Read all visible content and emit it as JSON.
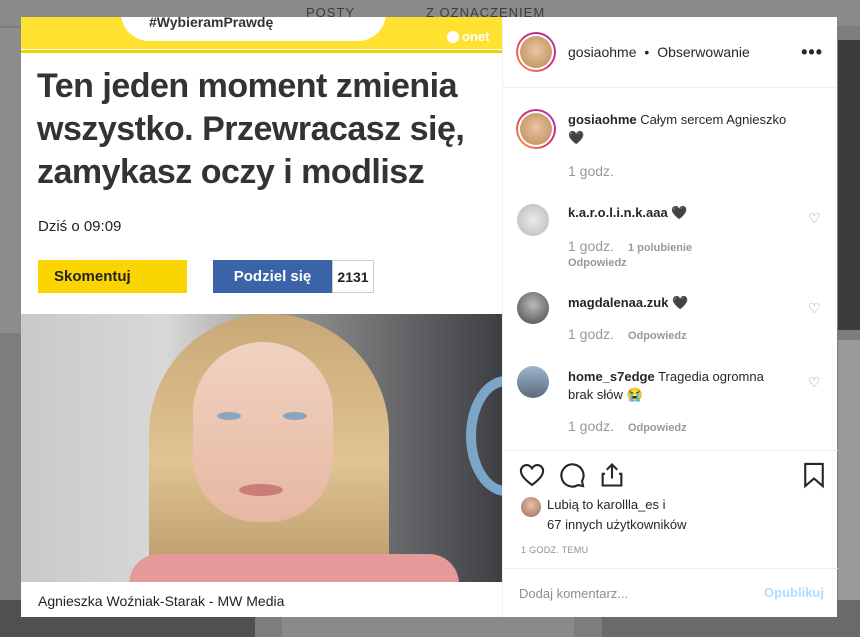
{
  "background": {
    "tabs": [
      "POSTY",
      "Z OZNACZENIEM"
    ]
  },
  "article": {
    "hashtag": "#WybieramPrawdę",
    "logo": "onet",
    "title": "Ten jeden moment zmienia wszystko. Przewracasz się, zamykasz oczy i modlisz",
    "date": "Dziś o 09:09",
    "comment_label": "Skomentuj",
    "share_label": "Podziel się",
    "share_count": "2131",
    "caption": "Agnieszka Woźniak-Starak - MW Media"
  },
  "header": {
    "username": "gosiaohme",
    "separator": "•",
    "follow": "Obserwowanie",
    "more_icon": "more-horizontal-icon"
  },
  "comments": [
    {
      "user": "gosiaohme",
      "text": "Całym sercem Agnieszko 🖤",
      "time": "1 godz."
    },
    {
      "user": "k.a.r.o.l.i.n.k.aaa",
      "text": "🖤",
      "time": "1 godz.",
      "likes": "1 polubienie",
      "reply": "Odpowiedz"
    },
    {
      "user": "magdalenaa.zuk",
      "text": "🖤",
      "time": "1 godz.",
      "reply": "Odpowiedz"
    },
    {
      "user": "home_s7edge",
      "text": "Tragedia ogromna brak słów 😭",
      "time": "1 godz.",
      "reply": "Odpowiedz"
    }
  ],
  "actions": {
    "icons": [
      "heart-icon",
      "comment-icon",
      "share-icon",
      "bookmark-icon"
    ],
    "likes_prefix": "Lubią to",
    "likes_user": "karollla_es",
    "likes_and": "i",
    "likes_others": "67 innych użytkowników",
    "posted": "1 GODZ. TEMU"
  },
  "add_comment": {
    "placeholder": "Dodaj komentarz...",
    "publish": "Opublikuj"
  },
  "colors": {
    "onet_yellow": "#ffe22f",
    "share_blue": "#3a63a8",
    "publish_disabled": "#b3dbff"
  }
}
